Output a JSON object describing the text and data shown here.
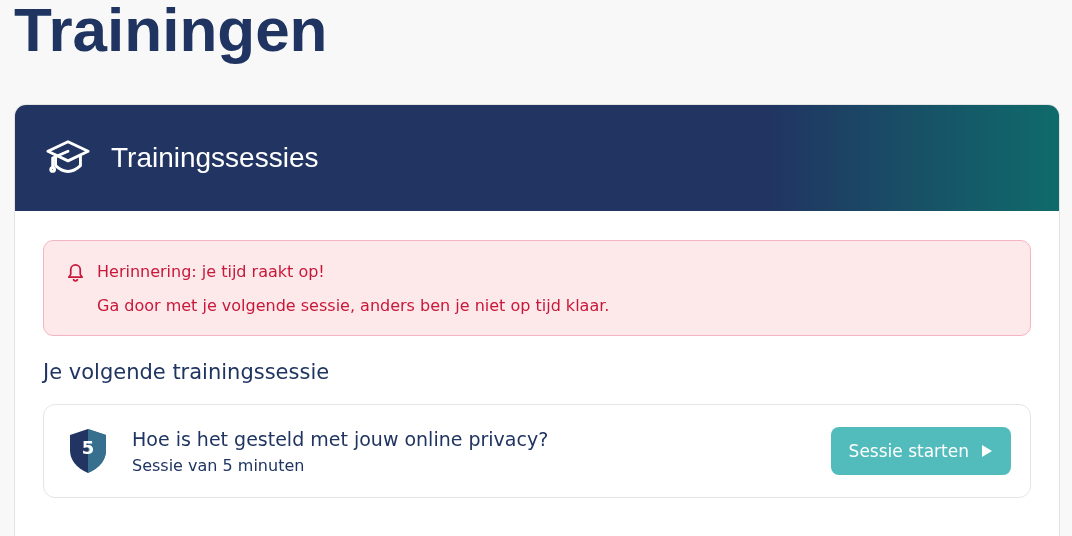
{
  "page_title": "Trainingen",
  "card": {
    "title": "Trainingssessies"
  },
  "alert": {
    "title": "Herinnering: je tijd raakt op!",
    "message": "Ga door met je volgende sessie, anders ben je niet op tijd klaar."
  },
  "next_session": {
    "heading": "Je volgende trainingssessie",
    "level_badge": "5",
    "title": "Hoe is het gesteld met jouw online privacy?",
    "duration": "Sessie van 5 minuten",
    "button": "Sessie starten"
  }
}
